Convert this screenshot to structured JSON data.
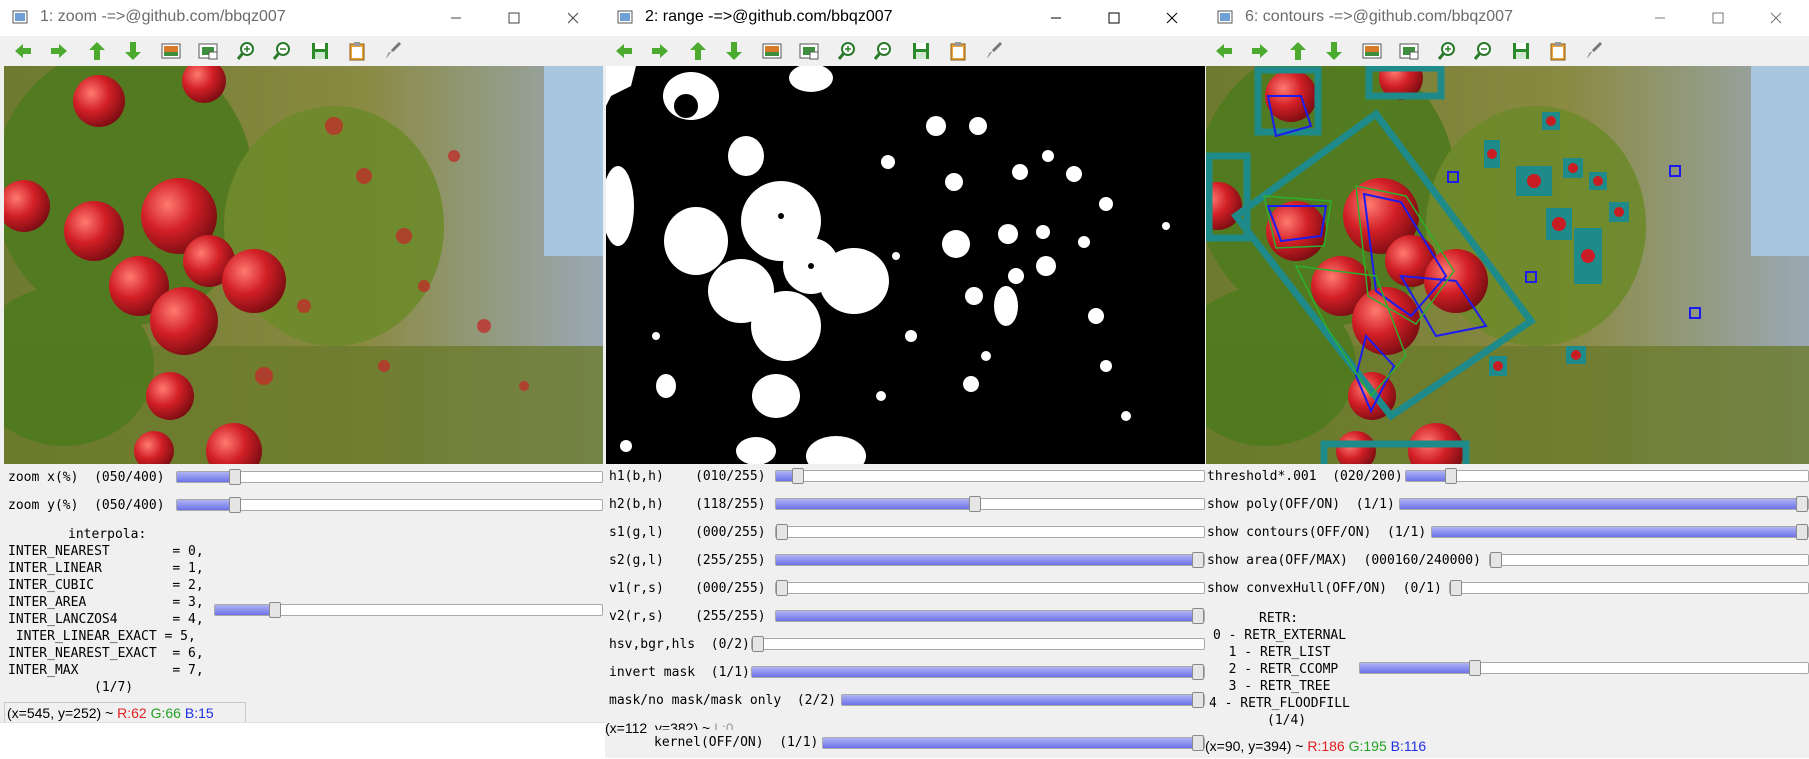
{
  "windows": [
    {
      "title": "1: zoom -=>@github.com/bbqz007",
      "sliders": [
        {
          "label": "zoom x(%)  (050/400)",
          "value": 50,
          "max": 400
        },
        {
          "label": "zoom y(%)  (050/400)",
          "value": 50,
          "max": 400
        }
      ],
      "interp_header": "interpola:",
      "interp_lines": [
        "INTER_NEAREST        = 0,",
        "INTER_LINEAR         = 1,",
        "INTER_CUBIC          = 2,",
        "INTER_AREA           = 3,",
        "INTER_LANCZOS4       = 4,",
        " INTER_LINEAR_EXACT = 5,",
        "INTER_NEAREST_EXACT  = 6,",
        "INTER_MAX            = 7,"
      ],
      "interp_value_label": "(1/7)",
      "interp_value": 1,
      "interp_max": 7,
      "status": {
        "coords": "(x=545, y=252) ~ ",
        "r": "R:62",
        "g": "G:66",
        "b": "B:15"
      }
    },
    {
      "title": "2: range -=>@github.com/bbqz007",
      "sliders": [
        {
          "label": "h1(b,h)    (010/255)",
          "value": 10,
          "max": 255
        },
        {
          "label": "h2(b,h)    (118/255)",
          "value": 118,
          "max": 255
        },
        {
          "label": "s1(g,l)    (000/255)",
          "value": 0,
          "max": 255
        },
        {
          "label": "s2(g,l)    (255/255)",
          "value": 255,
          "max": 255
        },
        {
          "label": "v1(r,s)    (000/255)",
          "value": 0,
          "max": 255
        },
        {
          "label": "v2(r,s)    (255/255)",
          "value": 255,
          "max": 255
        },
        {
          "label": "hsv,bgr,hls  (0/2)",
          "value": 0,
          "max": 2
        },
        {
          "label": "invert mask  (1/1)",
          "value": 1,
          "max": 1
        },
        {
          "label": "mask/no mask/mask only  (2/2)",
          "value": 2,
          "max": 2
        }
      ],
      "status": {
        "coords": "(x=112, y=382) ~ ",
        "gray": "L:0"
      },
      "kernel": {
        "label": "kernel(OFF/ON)  (1/1)",
        "value": 1,
        "max": 1
      }
    },
    {
      "title": "6: contours -=>@github.com/bbqz007",
      "sliders": [
        {
          "label": "threshold*.001  (020/200)",
          "value": 20,
          "max": 200
        },
        {
          "label": "show poly(OFF/ON)  (1/1)",
          "value": 1,
          "max": 1
        },
        {
          "label": "show contours(OFF/ON)  (1/1)",
          "value": 1,
          "max": 1
        },
        {
          "label": "show area(OFF/MAX)  (000160/240000)",
          "value": 160,
          "max": 240000
        },
        {
          "label": "show convexHull(OFF/ON)  (0/1)",
          "value": 0,
          "max": 1
        }
      ],
      "retr_header": "RETR:",
      "retr_lines": [
        "0 - RETR_EXTERNAL",
        "  1 - RETR_LIST",
        "  2 - RETR_CCOMP",
        "  3 - RETR_TREE",
        "4 - RETR_FLOODFILL"
      ],
      "retr_value_label": "(1/4)",
      "retr_value": 1,
      "retr_max": 4,
      "status": {
        "coords": "(x=90, y=394) ~ ",
        "r": "R:186",
        "g": "G:195",
        "b": "B:116"
      }
    }
  ],
  "colors": {
    "contour_teal": "#1f8a8a",
    "poly_blue": "#1c1cf0",
    "poly_green": "#2db02d",
    "apple_red": "#c81d22"
  },
  "icons": [
    "back-arrow-icon",
    "forward-arrow-icon",
    "up-arrow-icon",
    "down-arrow-icon",
    "image-icon",
    "fit-icon",
    "zoom-in-icon",
    "zoom-out-icon",
    "save-icon",
    "clipboard-icon",
    "brush-icon"
  ]
}
